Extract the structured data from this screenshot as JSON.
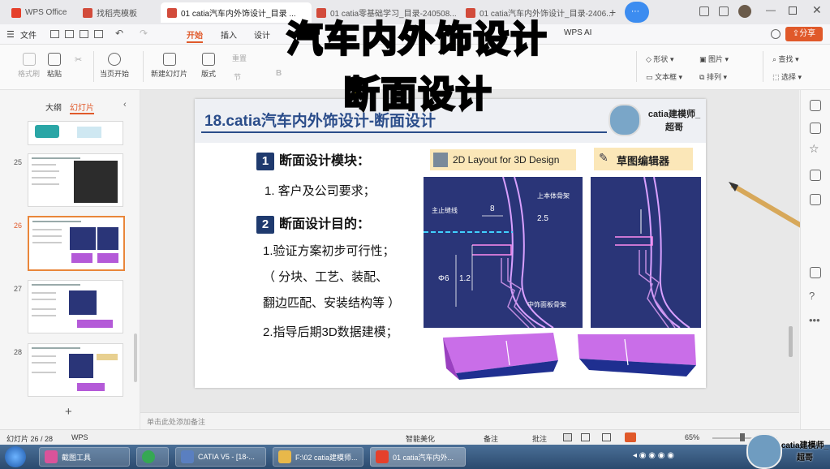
{
  "tabs": [
    {
      "label": "WPS Office",
      "color": "#e5402b"
    },
    {
      "label": "找稻壳模板",
      "color": "#d24b3b"
    },
    {
      "label": "01 catia汽车内外饰设计_目录 ...",
      "color": "#d24b3b"
    },
    {
      "label": "01 catia零基础学习_目录-240508...",
      "color": "#d24b3b"
    },
    {
      "label": "01 catia汽车内外饰设计_目录-2406...",
      "color": "#d24b3b"
    }
  ],
  "menu": {
    "file": "文件",
    "items": [
      "开始",
      "插入",
      "设计"
    ],
    "active": "开始",
    "wps_ai": "WPS AI",
    "share": "分享"
  },
  "ribbon": {
    "format_painter": "格式刷",
    "paste": "粘贴",
    "from_current": "当页开始",
    "new_slide": "新建幻灯片",
    "layout": "版式",
    "section": "节",
    "reset": "重置",
    "shape": "形状",
    "textbox": "文本框",
    "picture": "图片",
    "arrange": "排列",
    "find": "查找",
    "select": "选择"
  },
  "left_panel": {
    "tab_outline": "大纲",
    "tab_slides": "幻灯片",
    "slides": [
      {
        "num": "25"
      },
      {
        "num": "26"
      },
      {
        "num": "27"
      },
      {
        "num": "28"
      }
    ],
    "add": "+"
  },
  "slide": {
    "title": "18.catia汽车内外饰设计-断面设计",
    "brand": "catia建模师_超哥",
    "sec1_num": "1",
    "sec1_title": "断面设计模块：",
    "sec1_item": "1.  客户及公司要求；",
    "sec2_num": "2",
    "sec2_title": "断面设计目的：",
    "sec2_lines": [
      "1.验证方案初步可行性；",
      "（ 分块、工艺、装配、",
      "翻边匹配、安装结构等 ）",
      "2.指导后期3D数据建模；"
    ],
    "label_2d": "2D Layout for 3D Design",
    "label_sketch": "草图编辑器",
    "drawing": {
      "main_line": "主止缝线",
      "top_label": "上本体骨架",
      "dim_8": "8",
      "dim_25": "2.5",
      "dim_d6": "Φ6",
      "dim_12": "1.2",
      "bottom_label": "中饰面板骨架"
    }
  },
  "overlay": {
    "line1": "汽车内外饰设计",
    "line2": "断面设计"
  },
  "notes": "单击此处添加备注",
  "status": {
    "slide_info": "幻灯片 26 / 28",
    "theme": "WPS",
    "beautify": "智能美化",
    "notes": "备注",
    "comments": "批注",
    "zoom": "65%"
  },
  "taskbar": [
    {
      "label": "截图工具",
      "color": "#d9539a"
    },
    {
      "label": "",
      "color": "#35a853"
    },
    {
      "label": "CATIA V5 - [18-...",
      "color": "#5a7fc0"
    },
    {
      "label": "F:\\02 catia建模师...",
      "color": "#e8b84a"
    },
    {
      "label": "01 catia汽车内外...",
      "color": "#e5402b"
    }
  ],
  "watermark": "catia建模师_超哥",
  "colors": {
    "accent": "#e0592a",
    "slide_title": "#2b4d8a",
    "navy": "#1f3a6e",
    "drawing_bg": "#2a3578",
    "part_purple": "#b45ad8"
  }
}
